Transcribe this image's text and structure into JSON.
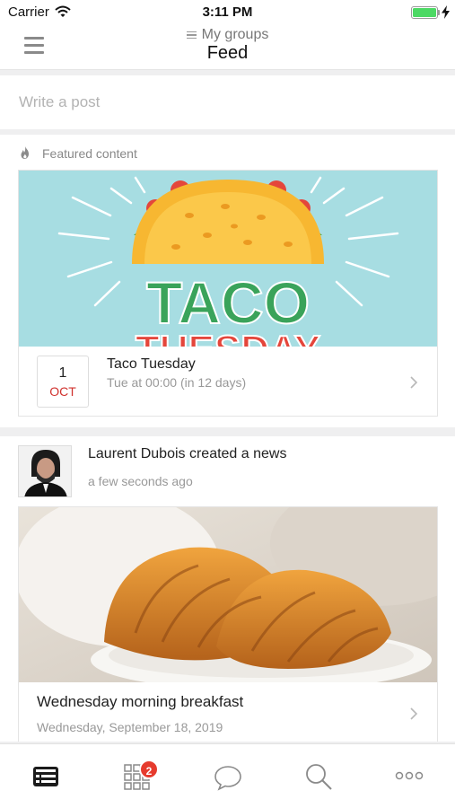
{
  "status_bar": {
    "carrier": "Carrier",
    "time": "3:11 PM",
    "wifi_icon": "wifi-icon",
    "battery_icon": "battery-icon",
    "battery_level": 1.0
  },
  "header": {
    "group_selector": "My groups",
    "title": "Feed",
    "menu_icon": "hamburger-menu-icon"
  },
  "composer": {
    "placeholder": "Write a post"
  },
  "featured": {
    "label": "Featured content",
    "icon": "fire-icon",
    "event": {
      "image_text": "TACO TUESDAY",
      "day": "1",
      "month": "OCT",
      "title": "Taco Tuesday",
      "subtitle": "Tue at 00:00 (in 12 days)"
    }
  },
  "news": {
    "author_line": "Laurent Dubois created a news",
    "time": "a few seconds ago",
    "title": "Wednesday morning breakfast",
    "date": "Wednesday, September 18, 2019"
  },
  "tab_bar": {
    "tabs": [
      {
        "name": "feed",
        "icon": "feed-icon",
        "active": true
      },
      {
        "name": "apps",
        "icon": "grid-icon",
        "badge": "2"
      },
      {
        "name": "messages",
        "icon": "chat-bubble-icon"
      },
      {
        "name": "search",
        "icon": "search-icon"
      },
      {
        "name": "more",
        "icon": "more-icon"
      }
    ]
  },
  "colors": {
    "accent_red": "#d0312d",
    "badge_red": "#e63b2e",
    "battery_green": "#4cd964",
    "taco_background": "#a7dde2",
    "taco_text_green": "#3aa35a"
  }
}
